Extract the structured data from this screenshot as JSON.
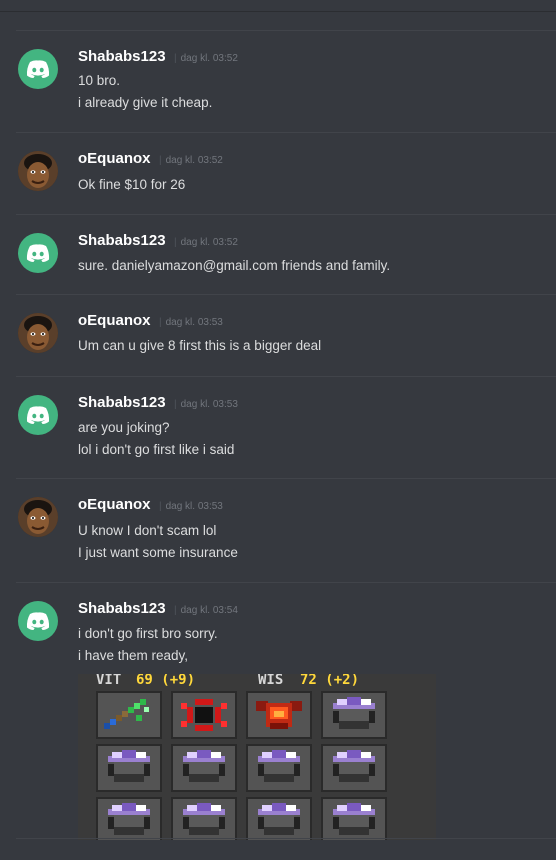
{
  "messages": [
    {
      "user": "Shababs123",
      "time": "dag kl. 03:52",
      "avatar": "discord-logo-icon",
      "lines": [
        "10 bro.",
        "i already give it cheap."
      ]
    },
    {
      "user": "oEquanox",
      "time": "dag kl. 03:52",
      "avatar": "user-avatar-face",
      "lines": [
        "Ok fine $10 for 26"
      ]
    },
    {
      "user": "Shababs123",
      "time": "dag kl. 03:52",
      "avatar": "discord-logo-icon",
      "lines": [
        "sure. danielyamazon@gmail.com friends and family."
      ]
    },
    {
      "user": "oEquanox",
      "time": "dag kl. 03:53",
      "avatar": "user-avatar-face",
      "lines": [
        "Um can u give 8 first this is a bigger deal"
      ]
    },
    {
      "user": "Shababs123",
      "time": "dag kl. 03:53",
      "avatar": "discord-logo-icon",
      "lines": [
        "are you joking?",
        "lol i don't go first like i said"
      ]
    },
    {
      "user": "oEquanox",
      "time": "dag kl. 03:53",
      "avatar": "user-avatar-face",
      "lines": [
        "U know I don't scam lol",
        "I just want some insurance"
      ]
    },
    {
      "user": "Shababs123",
      "time": "dag kl. 03:54",
      "avatar": "discord-logo-icon",
      "lines": [
        "i don't go first bro sorry.",
        "i have them ready,"
      ]
    }
  ],
  "attachment": {
    "stats": [
      {
        "label": "VIT",
        "value": "69 (+9)"
      },
      {
        "label": "WIS",
        "value": "72 (+2)"
      }
    ],
    "items": [
      "green-wand-icon",
      "red-ring-icon",
      "red-armor-icon",
      "purple-potion-icon",
      "purple-potion-icon",
      "purple-potion-icon",
      "purple-potion-icon",
      "purple-potion-icon",
      "purple-potion-icon",
      "purple-potion-icon",
      "purple-potion-icon",
      "purple-potion-icon"
    ]
  },
  "colors": {
    "background": "#36393f",
    "discord_green": "#43b581",
    "username": "#ffffff",
    "timestamp": "#72767d",
    "stat_yellow": "#ffd83b"
  }
}
